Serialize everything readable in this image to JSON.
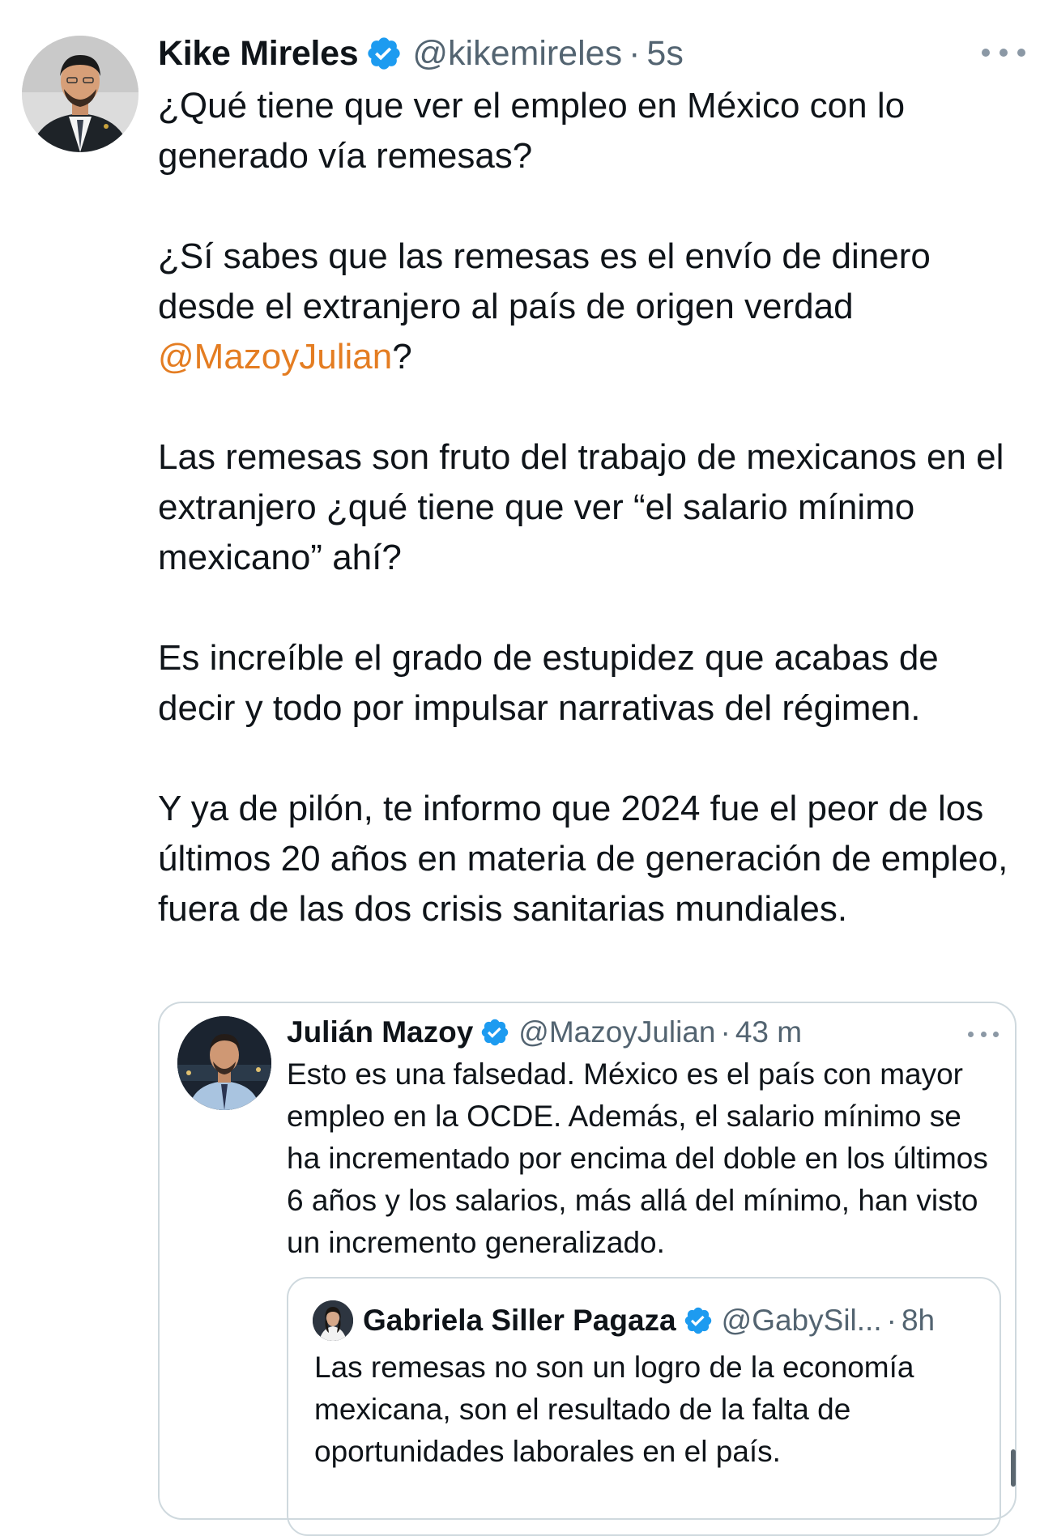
{
  "tweet": {
    "author_name": "Kike Mireles",
    "handle": "@kikemireles",
    "separator": "·",
    "time": "5s",
    "paragraphs": [
      {
        "before": "¿Qué tiene que ver el empleo en México con lo generado vía remesas?",
        "mention": "",
        "after": ""
      },
      {
        "before": "¿Sí sabes que las remesas es el envío de dinero desde el extranjero al país de origen verdad ",
        "mention": "@MazoyJulian",
        "after": "?"
      },
      {
        "before": "Las remesas son fruto del trabajo de mexicanos en el extranjero ¿qué tiene que ver “el salario mínimo mexicano” ahí?",
        "mention": "",
        "after": ""
      },
      {
        "before": "Es increíble el grado de estupidez que acabas de decir y todo por impulsar narrativas del régimen.",
        "mention": "",
        "after": ""
      },
      {
        "before": "Y ya de pilón, te informo que 2024 fue el peor de los últimos 20 años en materia de generación de empleo, fuera de las dos crisis sanitarias mundiales.",
        "mention": "",
        "after": ""
      }
    ]
  },
  "quoted": {
    "author_name": "Julián Mazoy",
    "handle": "@MazoyJulian",
    "separator": "·",
    "time": "43 m",
    "text": "Esto es una falsedad. México es el país con mayor empleo en la OCDE. Además, el salario mínimo se ha incrementado por encima del doble en los últimos 6 años y los salarios, más allá del mínimo, han visto un incremento generalizado."
  },
  "nested_quoted": {
    "author_name": "Gabriela Siller Pagaza",
    "handle": "@GabySil...",
    "separator": "·",
    "time": "8h",
    "text": "Las remesas no son un logro de la economía mexicana, son el resultado de la falta de oportunidades laborales en el país."
  },
  "colors": {
    "verified": "#1d9bf0",
    "mention": "#e47d22",
    "secondary_text": "#536471",
    "border": "#cfd9de"
  },
  "icons": {
    "verified": "verified-badge-icon",
    "more": "more-options-icon"
  }
}
